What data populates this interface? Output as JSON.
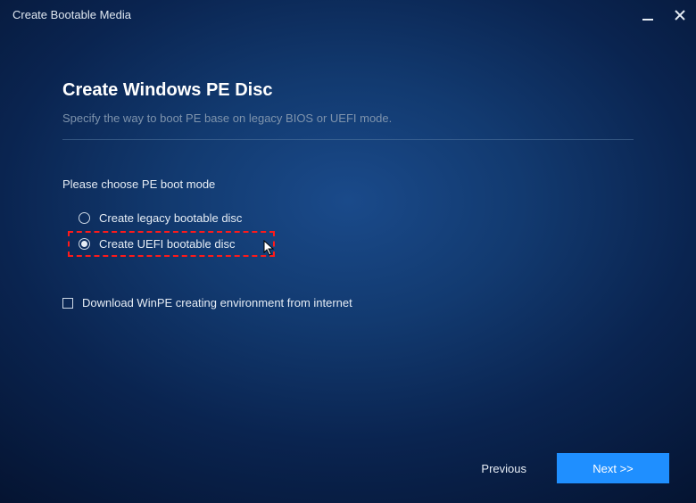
{
  "window": {
    "title": "Create Bootable Media"
  },
  "page": {
    "title": "Create Windows PE Disc",
    "subtitle": "Specify the way to boot PE base on legacy BIOS or UEFI mode."
  },
  "section": {
    "label": "Please choose PE boot mode",
    "options": [
      {
        "label": "Create legacy bootable disc",
        "selected": false
      },
      {
        "label": "Create UEFI bootable disc",
        "selected": true
      }
    ]
  },
  "download": {
    "label": "Download WinPE creating environment from internet",
    "checked": false
  },
  "footer": {
    "previous": "Previous",
    "next": "Next >>"
  }
}
